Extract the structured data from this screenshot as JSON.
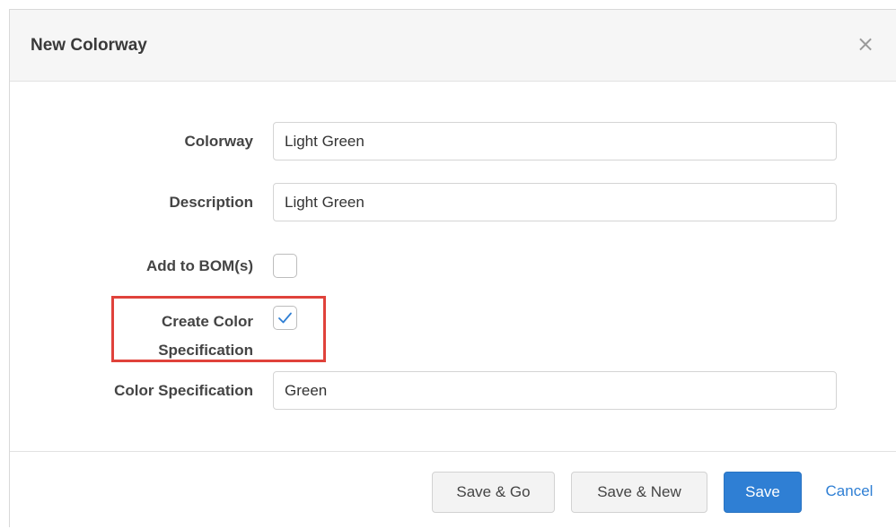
{
  "dialog": {
    "title": "New Colorway",
    "close_glyph": "×"
  },
  "form": {
    "colorway": {
      "label": "Colorway",
      "value": "Light Green"
    },
    "description": {
      "label": "Description",
      "value": "Light Green"
    },
    "add_to_bom": {
      "label": "Add to BOM(s)",
      "checked": false
    },
    "create_color_spec": {
      "label_line1": "Create Color",
      "label_line2": "Specification",
      "checked": true
    },
    "color_specification": {
      "label": "Color Specification",
      "value": "Green"
    }
  },
  "footer": {
    "save_go_label": "Save & Go",
    "save_new_label": "Save & New",
    "save_label": "Save",
    "cancel_label": "Cancel"
  },
  "colors": {
    "primary": "#2f7fd4",
    "highlight": "#e0423b",
    "check": "#2f7fd4"
  },
  "icons": {
    "close": "close-icon",
    "check": "checkmark-icon"
  }
}
